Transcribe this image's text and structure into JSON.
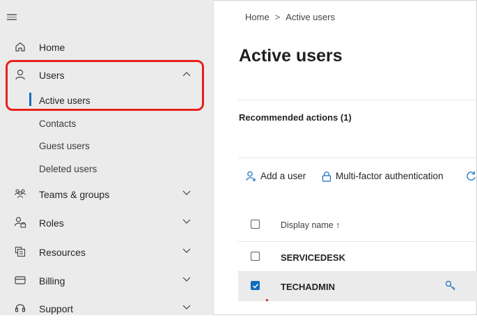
{
  "breadcrumb": {
    "home": "Home",
    "separator": ">",
    "current": "Active users"
  },
  "page_title": "Active users",
  "recommended_actions": "Recommended actions (1)",
  "commands": {
    "add_user": "Add a user",
    "mfa": "Multi-factor authentication"
  },
  "sidebar": {
    "items": [
      {
        "label": "Home",
        "icon": "home-icon"
      },
      {
        "label": "Users",
        "icon": "user-icon",
        "expanded": true
      },
      {
        "label": "Teams & groups",
        "icon": "group-icon"
      },
      {
        "label": "Roles",
        "icon": "roles-icon"
      },
      {
        "label": "Resources",
        "icon": "resources-icon"
      },
      {
        "label": "Billing",
        "icon": "billing-icon"
      },
      {
        "label": "Support",
        "icon": "headset-icon"
      }
    ],
    "users_sub": [
      {
        "label": "Active users",
        "active": true
      },
      {
        "label": "Contacts"
      },
      {
        "label": "Guest users"
      },
      {
        "label": "Deleted users"
      }
    ]
  },
  "table": {
    "header": "Display name ↑",
    "rows": [
      {
        "name": "SERVICEDESK",
        "checked": false
      },
      {
        "name": "TECHADMIN",
        "checked": true,
        "icon": "key-icon"
      }
    ]
  },
  "colors": {
    "accent": "#0f6cbd",
    "highlight": "#e8201c",
    "sidebar_bg": "#ebebeb"
  }
}
